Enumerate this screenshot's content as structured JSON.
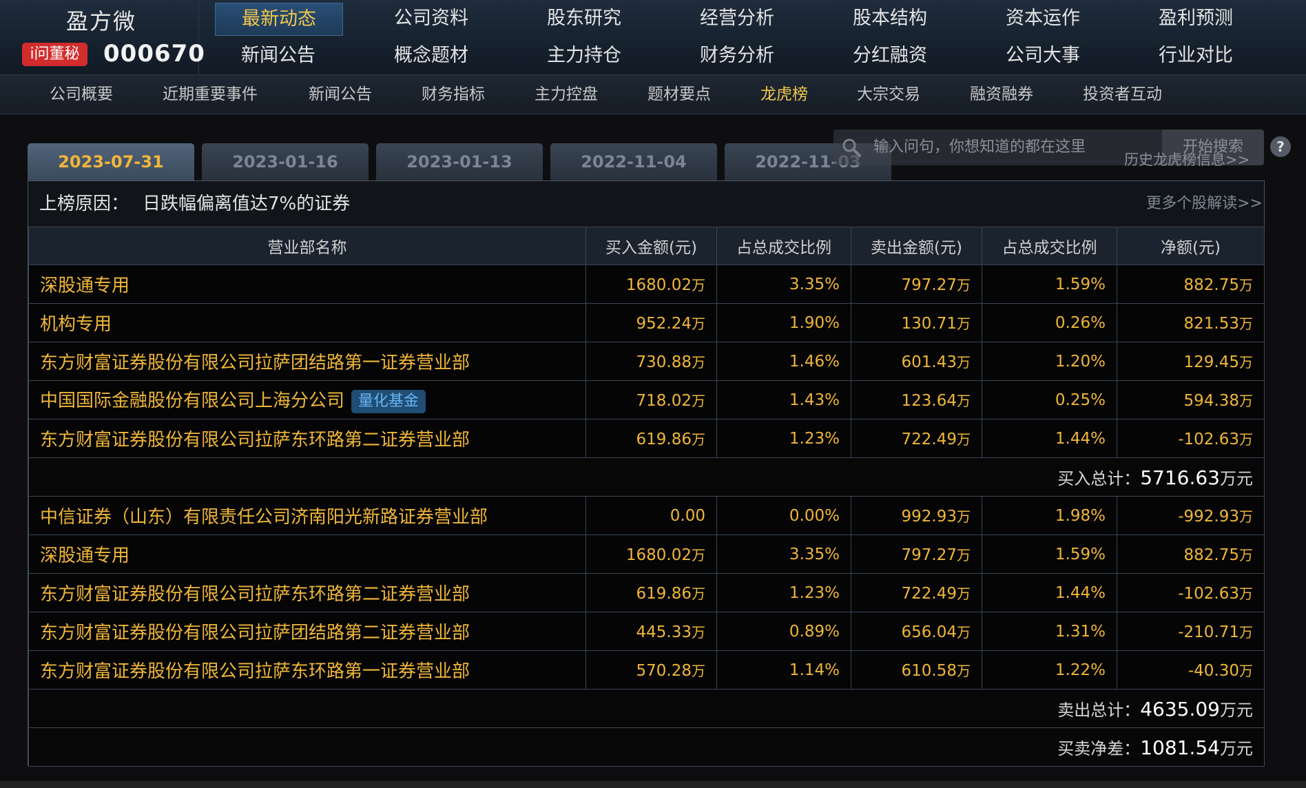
{
  "brand": {
    "name": "盈方微",
    "badge": "i问董秘",
    "code": "000670"
  },
  "topnav": [
    [
      "最新动态",
      "公司资料",
      "股东研究",
      "经营分析",
      "股本结构",
      "资本运作",
      "盈利预测"
    ],
    [
      "新闻公告",
      "概念题材",
      "主力持仓",
      "财务分析",
      "分红融资",
      "公司大事",
      "行业对比"
    ]
  ],
  "subnav": [
    "公司概要",
    "近期重要事件",
    "新闻公告",
    "财务指标",
    "主力控盘",
    "题材要点",
    "龙虎榜",
    "大宗交易",
    "融资融券",
    "投资者互动"
  ],
  "search": {
    "placeholder": "输入问句，你想知道的都在这里",
    "button": "开始搜索"
  },
  "history_link": "历史龙虎榜信息>>",
  "date_tabs": [
    "2023-07-31",
    "2023-01-16",
    "2023-01-13",
    "2022-11-04",
    "2022-11-03"
  ],
  "reason": {
    "label": "上榜原因：",
    "text": "日跌幅偏离值达7%的证券",
    "more": "更多个股解读>>"
  },
  "table": {
    "headers": [
      "营业部名称",
      "买入金额(元)",
      "占总成交比例",
      "卖出金额(元)",
      "占总成交比例",
      "净额(元)"
    ],
    "unit": "万",
    "buy_rows": [
      {
        "name": "深股通专用",
        "buy": "1680.02",
        "buy_pct": "3.35%",
        "sell": "797.27",
        "sell_pct": "1.59%",
        "net": "882.75"
      },
      {
        "name": "机构专用",
        "buy": "952.24",
        "buy_pct": "1.90%",
        "sell": "130.71",
        "sell_pct": "0.26%",
        "net": "821.53"
      },
      {
        "name": "东方财富证券股份有限公司拉萨团结路第一证券营业部",
        "buy": "730.88",
        "buy_pct": "1.46%",
        "sell": "601.43",
        "sell_pct": "1.20%",
        "net": "129.45"
      },
      {
        "name": "中国国际金融股份有限公司上海分公司",
        "tag": "量化基金",
        "buy": "718.02",
        "buy_pct": "1.43%",
        "sell": "123.64",
        "sell_pct": "0.25%",
        "net": "594.38"
      },
      {
        "name": "东方财富证券股份有限公司拉萨东环路第二证券营业部",
        "buy": "619.86",
        "buy_pct": "1.23%",
        "sell": "722.49",
        "sell_pct": "1.44%",
        "net": "-102.63"
      }
    ],
    "buy_total": {
      "label": "买入总计：",
      "value": "5716.63",
      "unit": "万元"
    },
    "sell_rows": [
      {
        "name": "中信证券（山东）有限责任公司济南阳光新路证券营业部",
        "buy": "0.00",
        "buy_unit": "",
        "buy_pct": "0.00%",
        "sell": "992.93",
        "sell_pct": "1.98%",
        "net": "-992.93"
      },
      {
        "name": "深股通专用",
        "buy": "1680.02",
        "buy_pct": "3.35%",
        "sell": "797.27",
        "sell_pct": "1.59%",
        "net": "882.75"
      },
      {
        "name": "东方财富证券股份有限公司拉萨东环路第二证券营业部",
        "buy": "619.86",
        "buy_pct": "1.23%",
        "sell": "722.49",
        "sell_pct": "1.44%",
        "net": "-102.63"
      },
      {
        "name": "东方财富证券股份有限公司拉萨团结路第二证券营业部",
        "buy": "445.33",
        "buy_pct": "0.89%",
        "sell": "656.04",
        "sell_pct": "1.31%",
        "net": "-210.71"
      },
      {
        "name": "东方财富证券股份有限公司拉萨东环路第一证券营业部",
        "buy": "570.28",
        "buy_pct": "1.14%",
        "sell": "610.58",
        "sell_pct": "1.22%",
        "net": "-40.30"
      }
    ],
    "sell_total": {
      "label": "卖出总计：",
      "value": "4635.09",
      "unit": "万元"
    },
    "net_total": {
      "label": "买卖净差：",
      "value": "1081.54",
      "unit": "万元"
    }
  }
}
